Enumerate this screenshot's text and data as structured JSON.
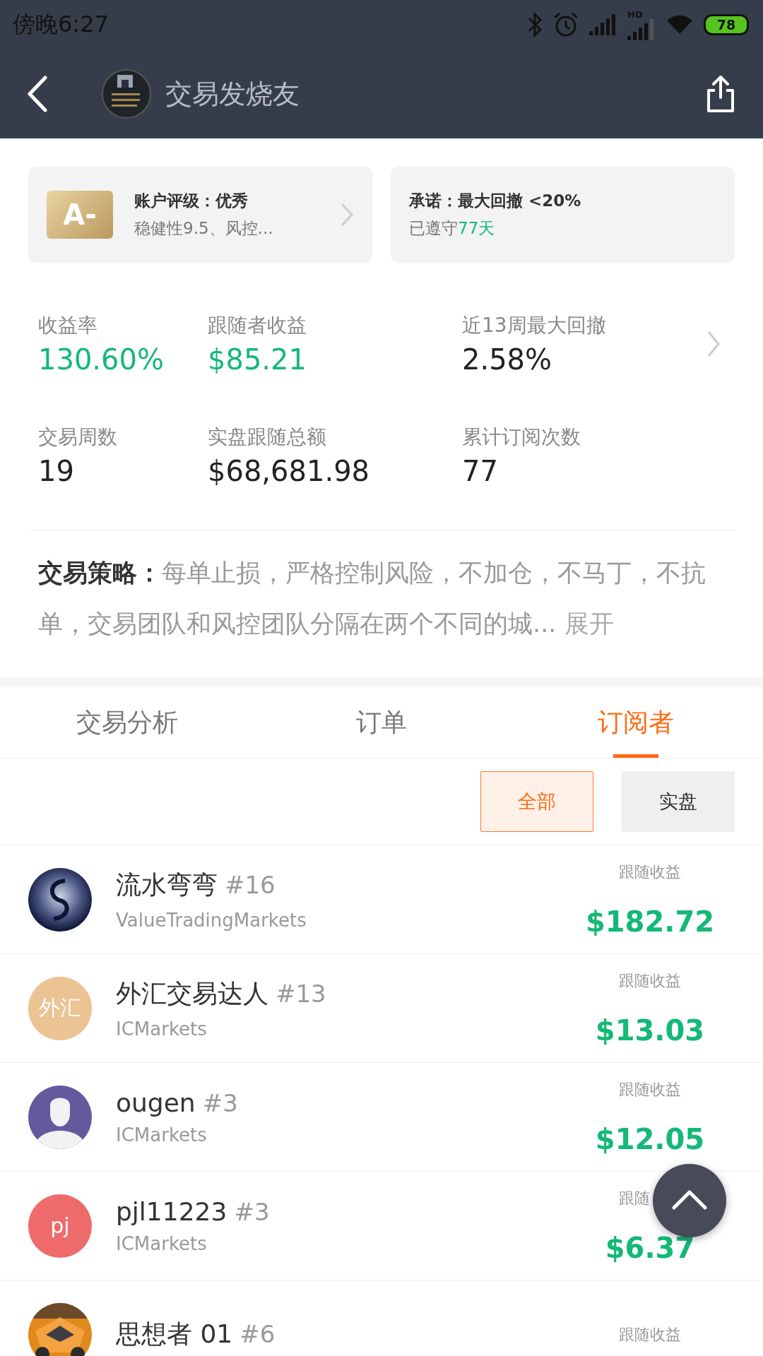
{
  "status_bar": {
    "time": "傍晚6:27",
    "hd_label": "HD",
    "battery": "78"
  },
  "header": {
    "title": "交易发烧友"
  },
  "cards": [
    {
      "kind": "rating",
      "badge": "A-",
      "title": "账户评级：优秀",
      "subtitle": "稳健性9.5、风控..."
    },
    {
      "kind": "promise",
      "title": "承诺：最大回撤 <20%",
      "subtitle": "已遵守",
      "highlight": "77天"
    }
  ],
  "stats": [
    {
      "label": "收益率",
      "value": "130.60%",
      "positive": true
    },
    {
      "label": "跟随者收益",
      "value": "$85.21",
      "positive": true
    },
    {
      "label": "近13周最大回撤",
      "value": "2.58%",
      "positive": false
    },
    {
      "label": "交易周数",
      "value": "19",
      "positive": false
    },
    {
      "label": "实盘跟随总额",
      "value": "$68,681.98",
      "positive": false
    },
    {
      "label": "累计订阅次数",
      "value": "77",
      "positive": false
    }
  ],
  "strategy": {
    "label": "交易策略：",
    "text": "每单止损，严格控制风险，不加仓，不马丁，不抗单，交易团队和风控团队分隔在两个不同的城...",
    "more": "展开"
  },
  "tabs": [
    {
      "label": "交易分析",
      "selected": false
    },
    {
      "label": "订单",
      "selected": false
    },
    {
      "label": "订阅者",
      "selected": true
    }
  ],
  "filters": [
    {
      "label": "全部",
      "selected": true
    },
    {
      "label": "实盘",
      "selected": false
    }
  ],
  "subscribers": [
    {
      "name": "流水弯弯",
      "rank": "#16",
      "broker": "ValueTradingMarkets",
      "label": "跟随收益",
      "value": "$182.72",
      "kind": "orb"
    },
    {
      "name": "外汇交易达人",
      "rank": "#13",
      "broker": "ICMarkets",
      "label": "跟随收益",
      "value": "$13.03",
      "kind": "text",
      "avatar_text": "外汇",
      "color": "#ecc393"
    },
    {
      "name": "ougen",
      "rank": "#3",
      "broker": "ICMarkets",
      "label": "跟随收益",
      "value": "$12.05",
      "kind": "person"
    },
    {
      "name": "pjl11223",
      "rank": "#3",
      "broker": "ICMarkets",
      "label": "跟随",
      "value": "$6.37",
      "kind": "text",
      "avatar_text": "pj",
      "color": "#ef6b6b"
    },
    {
      "name": "思想者 01",
      "rank": "#6",
      "label": "跟随收益",
      "kind": "picture"
    }
  ]
}
